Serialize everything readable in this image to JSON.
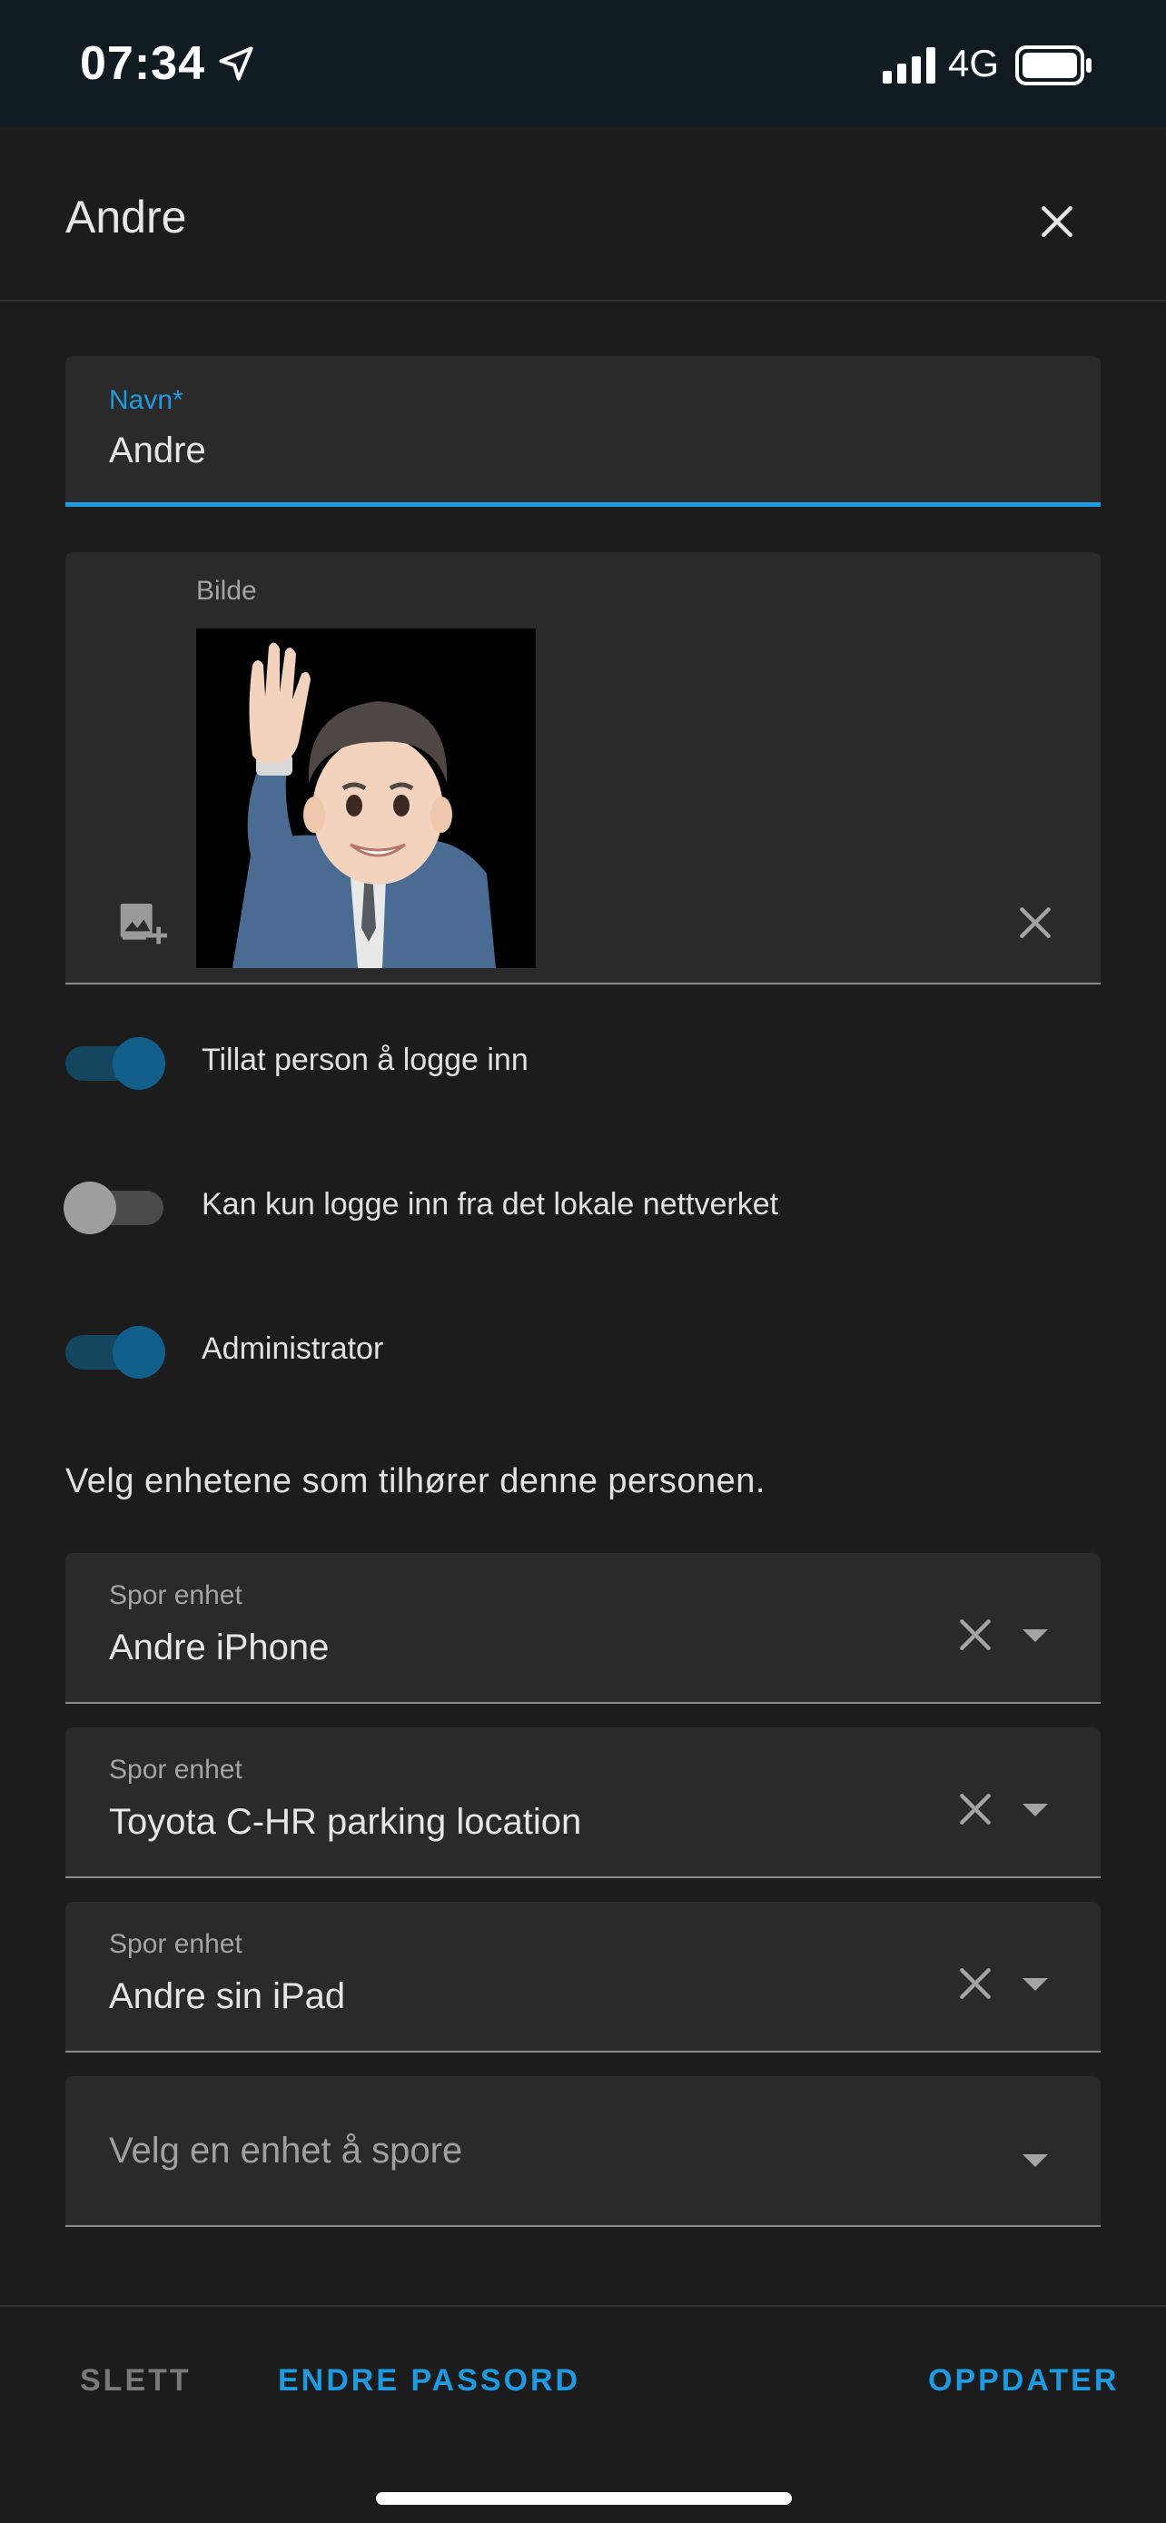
{
  "status_bar": {
    "time": "07:34",
    "network": "4G"
  },
  "dialog": {
    "title": "Andre",
    "name_field": {
      "label": "Navn*",
      "value": "Andre"
    },
    "picture": {
      "label": "Bilde"
    },
    "toggles": [
      {
        "label": "Tillat person å logge inn",
        "on": true
      },
      {
        "label": "Kan kun logge inn fra det lokale nettverket",
        "on": false
      },
      {
        "label": "Administrator",
        "on": true
      }
    ],
    "help_text": "Velg enhetene som tilhører denne personen.",
    "tracked_devices": [
      {
        "label": "Spor enhet",
        "value": "Andre iPhone"
      },
      {
        "label": "Spor enhet",
        "value": "Toyota C-HR parking location"
      },
      {
        "label": "Spor enhet",
        "value": "Andre sin iPad"
      }
    ],
    "new_device_placeholder": "Velg en enhet å spore"
  },
  "footer": {
    "delete_label": "SLETT",
    "password_label": "ENDRE PASSORD",
    "update_label": "OPPDATER"
  },
  "colors": {
    "accent": "#1e9be0",
    "background": "#1c1c1c",
    "field": "#2a2a2a",
    "toggle_on": "#125f8c"
  }
}
